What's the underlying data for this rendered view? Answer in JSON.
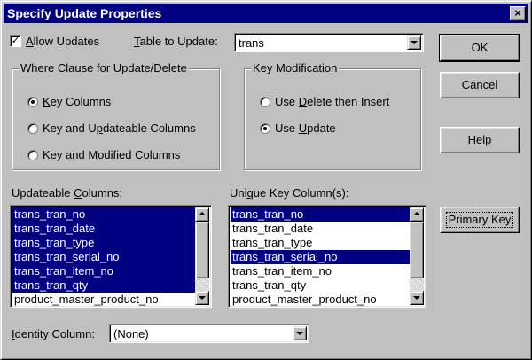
{
  "window": {
    "title": "Specify Update Properties",
    "close_label": "×"
  },
  "allow_updates": {
    "checked": true,
    "mark": "✓",
    "label_prefix": "",
    "label_ul": "A",
    "label_rest": "llow Updates"
  },
  "table_to_update": {
    "label_ul": "T",
    "label_rest": "able to Update:",
    "value": "trans"
  },
  "where_clause": {
    "title": "Where Clause for Update/Delete",
    "options": [
      {
        "pre": "",
        "ul": "K",
        "post": "ey Columns",
        "selected": true
      },
      {
        "pre": "Key and U",
        "ul": "p",
        "post": "dateable Columns",
        "selected": false
      },
      {
        "pre": "Key and ",
        "ul": "M",
        "post": "odified Columns",
        "selected": false
      }
    ]
  },
  "key_modification": {
    "title": "Key Modification",
    "options": [
      {
        "pre": "Use ",
        "ul": "D",
        "post": "elete then Insert",
        "selected": false
      },
      {
        "pre": "Use ",
        "ul": "U",
        "post": "pdate",
        "selected": true
      }
    ]
  },
  "buttons": {
    "ok": "OK",
    "cancel": "Cancel",
    "help_ul": "H",
    "help_rest": "elp",
    "primary_key": "Primary Key"
  },
  "updateable_columns": {
    "label_pre": "Updateable ",
    "label_ul": "C",
    "label_post": "olumns:",
    "items": [
      {
        "text": "trans_tran_no",
        "selected": true
      },
      {
        "text": "trans_tran_date",
        "selected": true
      },
      {
        "text": "trans_tran_type",
        "selected": true
      },
      {
        "text": "trans_tran_serial_no",
        "selected": true
      },
      {
        "text": "trans_tran_item_no",
        "selected": true
      },
      {
        "text": "trans_tran_qty",
        "selected": true
      },
      {
        "text": "product_master_product_no",
        "selected": false
      }
    ]
  },
  "unique_key_columns": {
    "label_pre": "Uni",
    "label_ul": "q",
    "label_post": "ue Key Column(s):",
    "items": [
      {
        "text": "trans_tran_no",
        "selected": true
      },
      {
        "text": "trans_tran_date",
        "selected": false
      },
      {
        "text": "trans_tran_type",
        "selected": false
      },
      {
        "text": "trans_tran_serial_no",
        "selected": true
      },
      {
        "text": "trans_tran_item_no",
        "selected": false
      },
      {
        "text": "trans_tran_qty",
        "selected": false
      },
      {
        "text": "product_master_product_no",
        "selected": false
      }
    ]
  },
  "identity_column": {
    "label_ul": "I",
    "label_rest": "dentity Column:",
    "value": "(None)"
  },
  "colors": {
    "selection": "#000080",
    "face": "#c0c0c0",
    "title_bar": "#000080"
  },
  "icons": {
    "close": "close-icon",
    "dropdown": "chevron-down-icon",
    "scroll_up": "arrow-up-icon",
    "scroll_down": "arrow-down-icon"
  }
}
